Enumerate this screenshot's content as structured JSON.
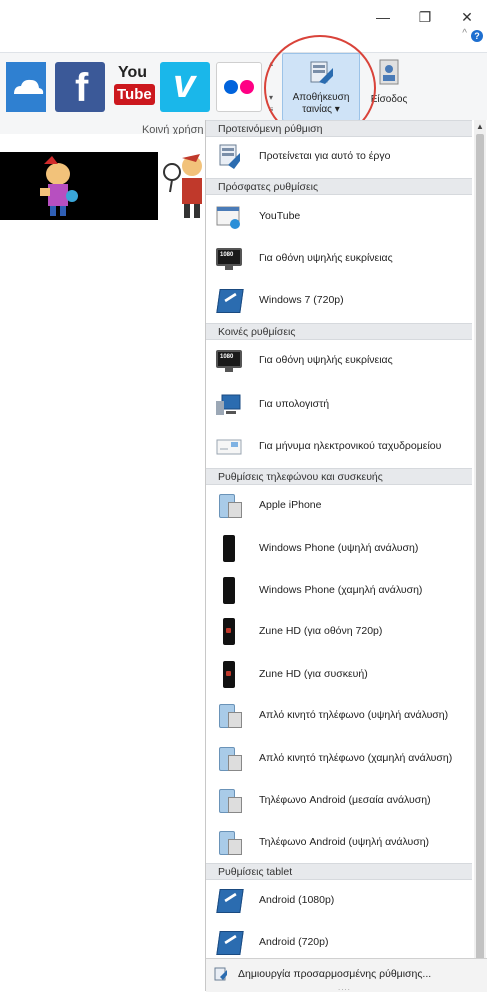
{
  "window": {
    "minimize_glyph": "—",
    "restore_glyph": "❐",
    "close_glyph": "✕",
    "help_glyph": "?",
    "collapse_glyph": "^"
  },
  "ribbon": {
    "share_group_label": "Κοινή χρήση",
    "share_buttons": [
      "onedrive-icon",
      "facebook-icon",
      "youtube-icon",
      "vimeo-icon",
      "flickr-icon"
    ],
    "youtube_logo_text_top": "You",
    "youtube_logo_text_bottom": "Tube",
    "facebook_logo_text": "f",
    "vimeo_logo_text": "v",
    "save_movie_label_line1": "Αποθήκευση",
    "save_movie_label_line2": "ταινίας ▾",
    "sign_in_label": "Είσοδος"
  },
  "dropdown": {
    "sections": [
      {
        "title": "Προτεινόμενη ρύθμιση",
        "items": [
          {
            "label": "Προτείνεται για αυτό το έργο",
            "icon": "recommended-icon"
          }
        ]
      },
      {
        "title": "Πρόσφατες ρυθμίσεις",
        "items": [
          {
            "label": "YouTube",
            "icon": "youtube-settings-icon"
          },
          {
            "label": "Για οθόνη υψηλής ευκρίνειας",
            "icon": "hd-monitor-icon"
          },
          {
            "label": "Windows 7 (720p)",
            "icon": "tablet-icon"
          }
        ]
      },
      {
        "title": "Κοινές ρυθμίσεις",
        "items": [
          {
            "label": "Για οθόνη υψηλής ευκρίνειας",
            "icon": "hd-monitor-icon"
          },
          {
            "label": "Για υπολογιστή",
            "icon": "computer-icon"
          },
          {
            "label": "Για μήνυμα ηλεκτρονικού ταχυδρομείου",
            "icon": "email-icon"
          }
        ]
      },
      {
        "title": "Ρυθμίσεις τηλεφώνου και συσκευής",
        "items": [
          {
            "label": "Apple iPhone",
            "icon": "device-icon"
          },
          {
            "label": "Windows Phone (υψηλή ανάλυση)",
            "icon": "windows-phone-icon"
          },
          {
            "label": "Windows Phone (χαμηλή ανάλυση)",
            "icon": "windows-phone-icon"
          },
          {
            "label": "Zune HD (για οθόνη 720p)",
            "icon": "zune-icon"
          },
          {
            "label": "Zune HD (για συσκευή)",
            "icon": "zune-icon"
          },
          {
            "label": "Απλό κινητό τηλέφωνο (υψηλή ανάλυση)",
            "icon": "device-icon"
          },
          {
            "label": "Απλό κινητό τηλέφωνο (χαμηλή ανάλυση)",
            "icon": "device-icon"
          },
          {
            "label": "Τηλέφωνο Android (μεσαία ανάλυση)",
            "icon": "device-icon"
          },
          {
            "label": "Τηλέφωνο Android (υψηλή ανάλυση)",
            "icon": "device-icon"
          }
        ]
      },
      {
        "title": "Ρυθμίσεις tablet",
        "items": [
          {
            "label": "Android (1080p)",
            "icon": "tablet-icon"
          },
          {
            "label": "Android (720p)",
            "icon": "tablet-icon"
          }
        ]
      }
    ],
    "footer_label": "Δημιουργία προσαρμοσμένης ρύθμισης...",
    "footer_grip": "....",
    "scroll_up_glyph": "▲",
    "scroll_down_glyph": "▼"
  },
  "colors": {
    "highlight_circle": "#d9433a",
    "save_button_bg": "#cfe3f7",
    "facebook": "#3b5998",
    "youtube": "#cc181e",
    "vimeo": "#1ab7ea",
    "onedrive": "#2f80d1"
  }
}
